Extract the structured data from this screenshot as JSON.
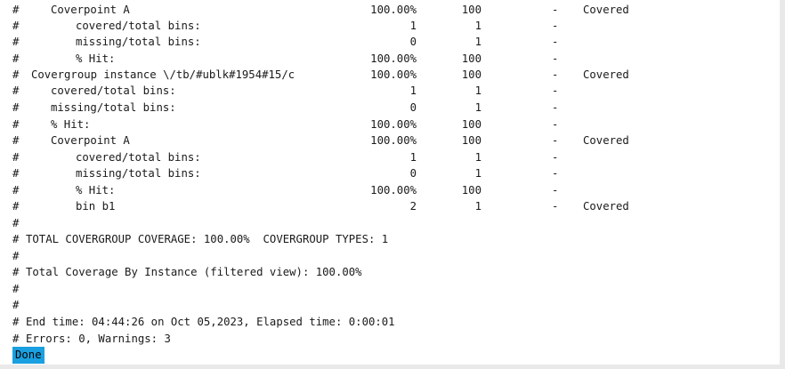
{
  "console": {
    "rows": [
      {
        "hash": "#",
        "label": "Coverpoint A",
        "indent": 3,
        "pct": "100.00%",
        "cnt": "100",
        "dash": "-",
        "status": "Covered"
      },
      {
        "hash": "#",
        "label": "covered/total bins:",
        "indent": 4,
        "pct": "1",
        "cnt": "1",
        "dash": "-",
        "status": ""
      },
      {
        "hash": "#",
        "label": "missing/total bins:",
        "indent": 4,
        "pct": "0",
        "cnt": "1",
        "dash": "-",
        "status": ""
      },
      {
        "hash": "#",
        "label": "% Hit:",
        "indent": 4,
        "pct": "100.00%",
        "cnt": "100",
        "dash": "-",
        "status": ""
      },
      {
        "hash": "#",
        "label": "Covergroup instance \\/tb/#ublk#1954#15/c",
        "indent": 2,
        "pct": "100.00%",
        "cnt": "100",
        "dash": "-",
        "status": "Covered"
      },
      {
        "hash": "#",
        "label": "covered/total bins:",
        "indent": 3,
        "pct": "1",
        "cnt": "1",
        "dash": "-",
        "status": ""
      },
      {
        "hash": "#",
        "label": "missing/total bins:",
        "indent": 3,
        "pct": "0",
        "cnt": "1",
        "dash": "-",
        "status": ""
      },
      {
        "hash": "#",
        "label": "% Hit:",
        "indent": 3,
        "pct": "100.00%",
        "cnt": "100",
        "dash": "-",
        "status": ""
      },
      {
        "hash": "#",
        "label": "Coverpoint A",
        "indent": 3,
        "pct": "100.00%",
        "cnt": "100",
        "dash": "-",
        "status": "Covered"
      },
      {
        "hash": "#",
        "label": "covered/total bins:",
        "indent": 4,
        "pct": "1",
        "cnt": "1",
        "dash": "-",
        "status": ""
      },
      {
        "hash": "#",
        "label": "missing/total bins:",
        "indent": 4,
        "pct": "0",
        "cnt": "1",
        "dash": "-",
        "status": ""
      },
      {
        "hash": "#",
        "label": "% Hit:",
        "indent": 4,
        "pct": "100.00%",
        "cnt": "100",
        "dash": "-",
        "status": ""
      },
      {
        "hash": "#",
        "label": "bin b1",
        "indent": 4,
        "pct": "2",
        "cnt": "1",
        "dash": "-",
        "status": "Covered"
      },
      {
        "hash": "#",
        "label": "",
        "indent": 1,
        "pct": "",
        "cnt": "",
        "dash": "",
        "status": ""
      },
      {
        "hash": "#",
        "label": "TOTAL COVERGROUP COVERAGE: 100.00%  COVERGROUP TYPES: 1",
        "indent": 1,
        "pct": "",
        "cnt": "",
        "dash": "",
        "status": ""
      },
      {
        "hash": "#",
        "label": "",
        "indent": 1,
        "pct": "",
        "cnt": "",
        "dash": "",
        "status": ""
      },
      {
        "hash": "#",
        "label": "Total Coverage By Instance (filtered view): 100.00%",
        "indent": 1,
        "pct": "",
        "cnt": "",
        "dash": "",
        "status": ""
      },
      {
        "hash": "#",
        "label": "",
        "indent": 1,
        "pct": "",
        "cnt": "",
        "dash": "",
        "status": ""
      },
      {
        "hash": "#",
        "label": "",
        "indent": 1,
        "pct": "",
        "cnt": "",
        "dash": "",
        "status": ""
      },
      {
        "hash": "#",
        "label": "End time: 04:44:26 on Oct 05,2023, Elapsed time: 0:00:01",
        "indent": 1,
        "pct": "",
        "cnt": "",
        "dash": "",
        "status": ""
      },
      {
        "hash": "#",
        "label": "Errors: 0, Warnings: 3",
        "indent": 1,
        "pct": "",
        "cnt": "",
        "dash": "",
        "status": ""
      }
    ]
  },
  "status": {
    "done_label": "Done"
  },
  "colors": {
    "done_bg": "#1aa0e0",
    "text": "#1a1a1a",
    "background": "#ffffff"
  }
}
